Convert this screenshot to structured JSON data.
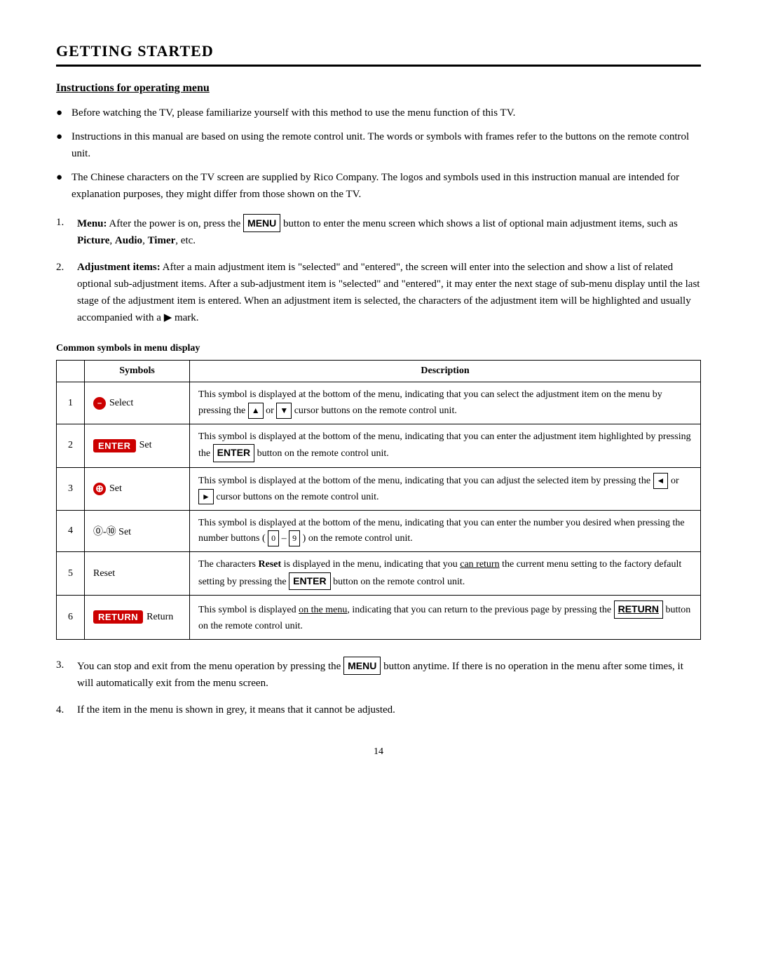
{
  "page": {
    "title": "GETTING STARTED",
    "page_number": "14"
  },
  "instructions_heading": "Instructions for operating menu",
  "bullets": [
    "Before watching the TV, please familiarize yourself with this method to use the menu function of this TV.",
    "Instructions in this manual are based on using the remote control unit. The words or symbols with frames refer to the buttons on the remote control unit.",
    "The Chinese characters on the TV screen are supplied by Rico Company. The logos and symbols used in this instruction manual are intended for explanation purposes, they might differ from those shown on the TV."
  ],
  "numbered_items": [
    {
      "number": "1.",
      "bold_label": "Menu:",
      "text": "After the power is on, press the",
      "key": "MENU",
      "text2": "button to enter the menu screen which shows a list of optional main adjustment items, such as",
      "items": "Picture, Audio, Timer",
      "text3": ", etc."
    },
    {
      "number": "2.",
      "bold_label": "Adjustment items:",
      "text": "After a main adjustment item is \"selected\" and \"entered\", the screen will enter into the selection and show a list of related optional sub-adjustment items. After a sub-adjustment item is \"selected\" and \"entered\", it may enter the next stage of sub-menu display until the last stage of the adjustment item is entered. When an adjustment item is selected, the characters of the adjustment item will be highlighted and usually accompanied with a ▶ mark."
    }
  ],
  "table": {
    "caption": "Common symbols in menu display",
    "headers": [
      "",
      "Symbols",
      "Description"
    ],
    "rows": [
      {
        "num": "1",
        "symbol_type": "select",
        "symbol_label": "Select",
        "description": "This symbol is displayed at the bottom of the menu, indicating that you can select the adjustment item on the menu by pressing the ▲ or ▼ cursor buttons on the remote control unit."
      },
      {
        "num": "2",
        "symbol_type": "enter_btn",
        "symbol_label": "Set",
        "description": "This symbol is displayed at the bottom of the menu, indicating that you can enter the adjustment item highlighted by pressing the ENTER button on the remote control unit."
      },
      {
        "num": "3",
        "symbol_type": "plus_minus",
        "symbol_label": "Set",
        "description": "This symbol is displayed at the bottom of the menu, indicating that you can adjust the selected item by pressing the ◄ or ► cursor buttons on the remote control unit."
      },
      {
        "num": "4",
        "symbol_type": "zero_nine",
        "symbol_label": "Set",
        "description": "This symbol is displayed at the bottom of the menu, indicating that you can enter the number you desired when pressing the number buttons ( 0 – 9 ) on the remote control unit."
      },
      {
        "num": "5",
        "symbol_type": "reset",
        "symbol_label": "Reset",
        "description": "The characters Reset is displayed in the menu, indicating that you can return the current menu setting to the factory default setting by pressing the ENTER button on the remote control unit."
      },
      {
        "num": "6",
        "symbol_type": "return_btn",
        "symbol_label": "Return",
        "description": "This symbol is displayed on the menu, indicating that you can return to the previous page by pressing the RETURN button on the remote control unit."
      }
    ]
  },
  "bottom_numbered": [
    {
      "number": "3.",
      "text": "You can stop and exit from the menu operation by pressing the",
      "key": "MENU",
      "text2": "button anytime. If there is no operation in the menu after some times, it will automatically exit from the menu screen."
    },
    {
      "number": "4.",
      "text": "If the item in the menu is shown in grey, it means that it cannot be adjusted."
    }
  ]
}
